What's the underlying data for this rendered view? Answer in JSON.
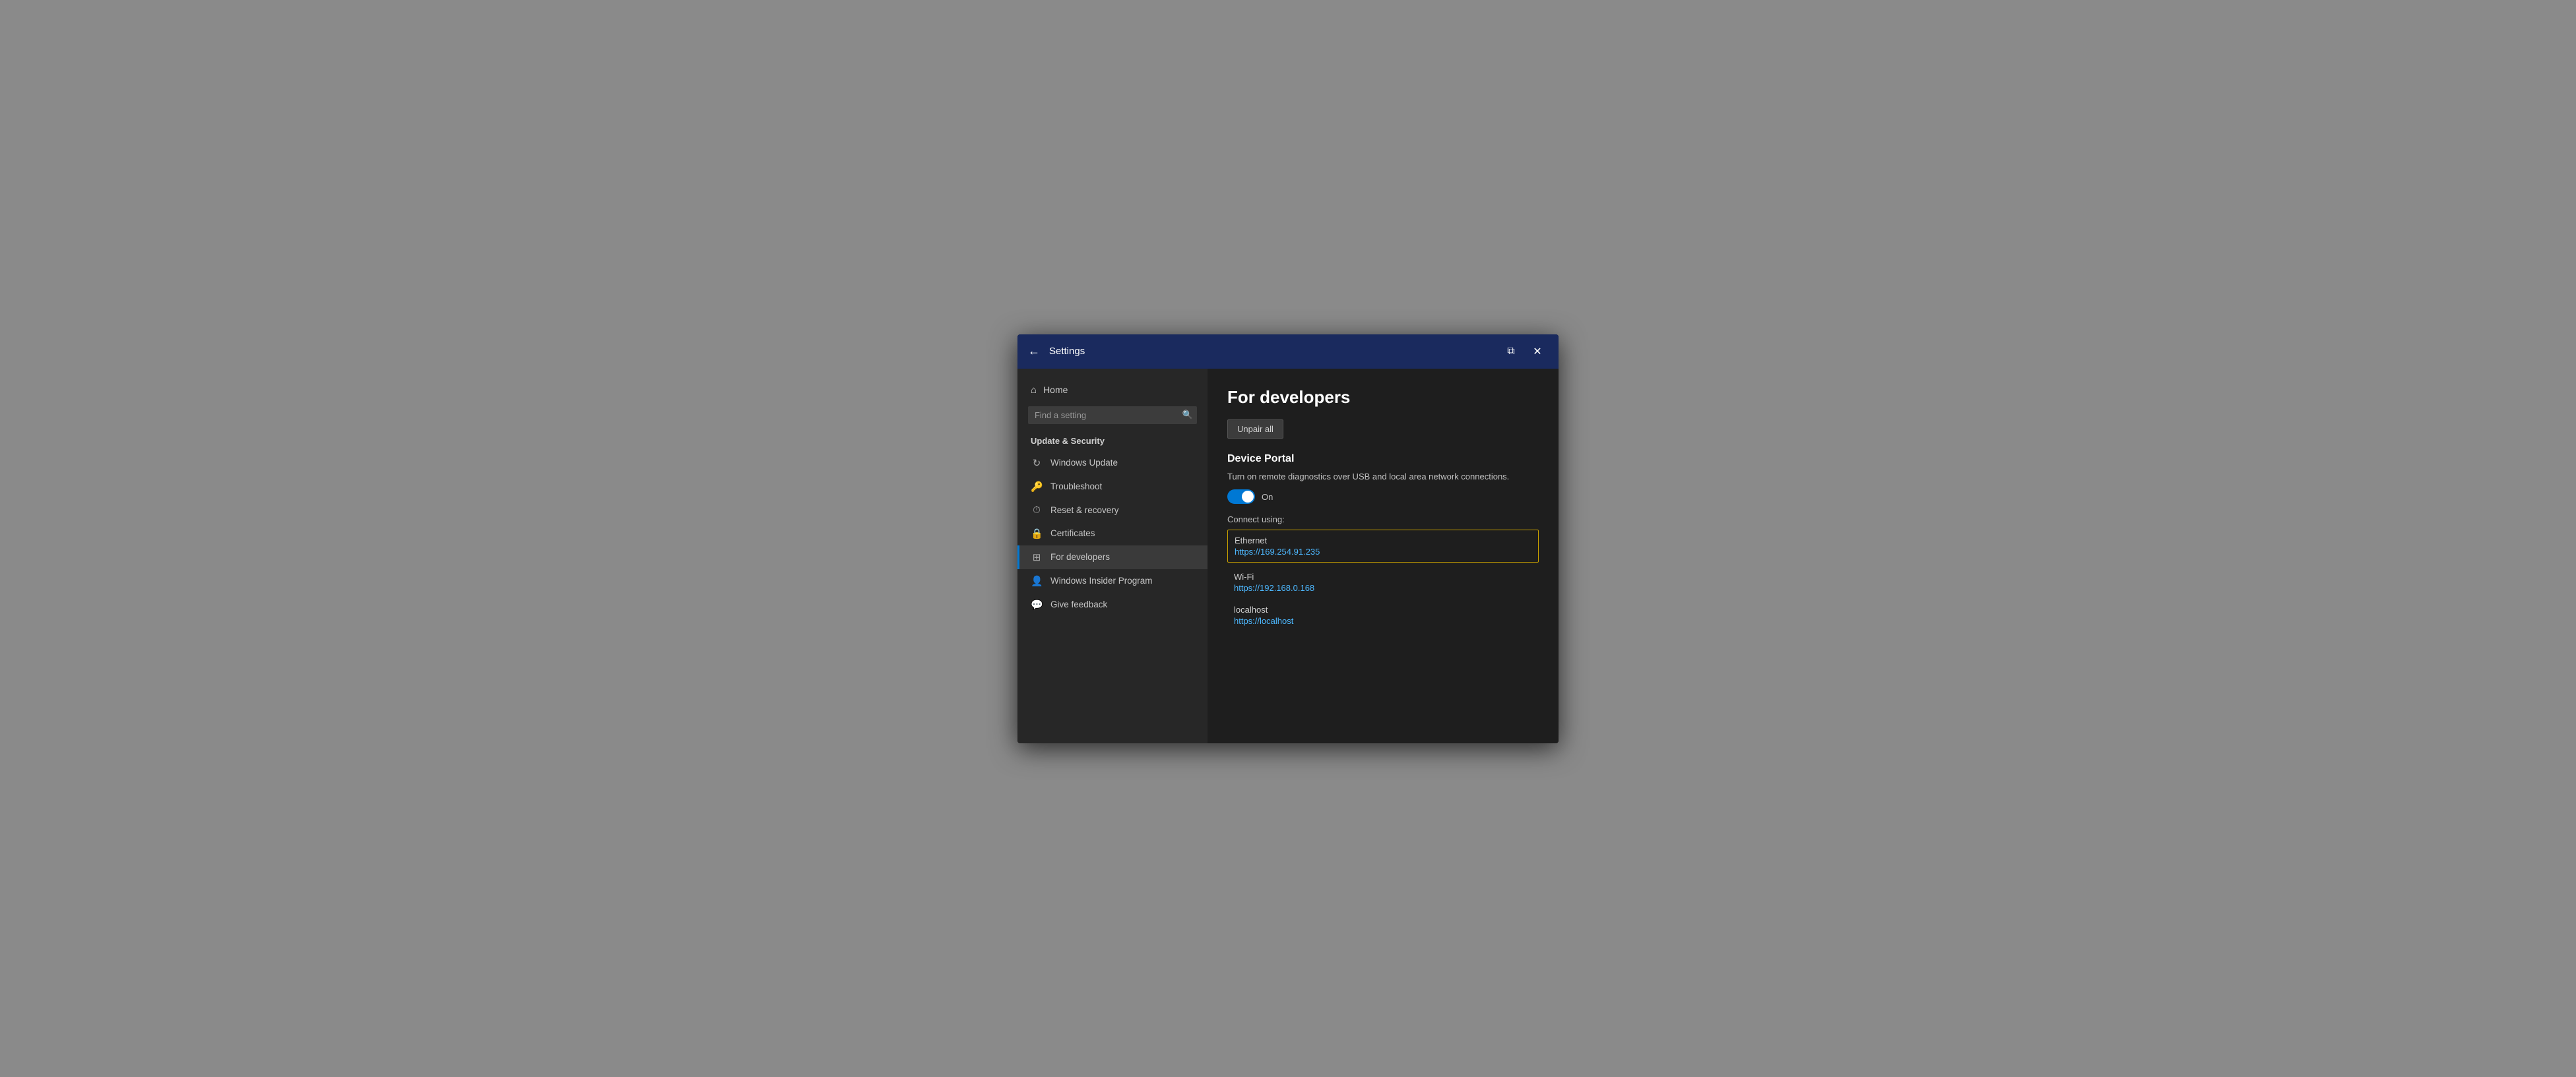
{
  "titlebar": {
    "back_label": "←",
    "title": "Settings",
    "restore_icon": "⧉",
    "close_icon": "✕"
  },
  "sidebar": {
    "home_label": "Home",
    "home_icon": "⌂",
    "search_placeholder": "Find a setting",
    "search_icon": "🔍",
    "section_title": "Update & Security",
    "nav_items": [
      {
        "id": "windows-update",
        "label": "Windows Update",
        "icon": "↻"
      },
      {
        "id": "troubleshoot",
        "label": "Troubleshoot",
        "icon": "🔑"
      },
      {
        "id": "reset-recovery",
        "label": "Reset & recovery",
        "icon": "⏱"
      },
      {
        "id": "certificates",
        "label": "Certificates",
        "icon": "🔒"
      },
      {
        "id": "for-developers",
        "label": "For developers",
        "icon": "⊞",
        "active": true
      },
      {
        "id": "windows-insider",
        "label": "Windows Insider Program",
        "icon": "👤"
      },
      {
        "id": "give-feedback",
        "label": "Give feedback",
        "icon": "💬"
      }
    ]
  },
  "main": {
    "page_title": "For developers",
    "unpair_btn": "Unpair all",
    "device_portal_title": "Device Portal",
    "device_portal_desc": "Turn on remote diagnostics over USB and local area network connections.",
    "toggle_state": "On",
    "connect_label": "Connect using:",
    "connections": [
      {
        "id": "ethernet",
        "name": "Ethernet",
        "url": "https://169.254.91.235",
        "highlighted": true
      },
      {
        "id": "wifi",
        "name": "Wi-Fi",
        "url": "https://192.168.0.168",
        "highlighted": false
      },
      {
        "id": "localhost",
        "name": "localhost",
        "url": "https://localhost",
        "highlighted": false
      }
    ]
  }
}
